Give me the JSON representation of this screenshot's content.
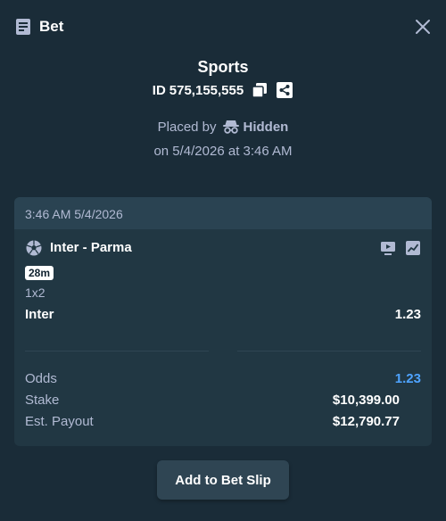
{
  "header": {
    "title": "Bet",
    "icon": "bet-slip-icon",
    "close_icon": "close-icon"
  },
  "bet": {
    "category": "Sports",
    "id_prefix": "ID",
    "id_value": "575,155,555",
    "placed_by_label": "Placed by",
    "placed_by_user": "Hidden",
    "date_line": "on 5/4/2026 at 3:46 AM"
  },
  "card": {
    "timestamp": "3:46 AM 5/4/2026",
    "event": {
      "name": "Inter - Parma",
      "sport_icon": "soccer-ball-icon",
      "time_badge": "28m",
      "market": "1x2",
      "selection": "Inter",
      "selection_odds": "1.23"
    },
    "summary": {
      "odds_label": "Odds",
      "odds_value": "1.23",
      "stake_label": "Stake",
      "stake_value": "$10,399.00",
      "payout_label": "Est. Payout",
      "payout_value": "$12,790.77"
    }
  },
  "actions": {
    "add_to_slip_label": "Add to Bet Slip"
  },
  "colors": {
    "background": "#1a2c38",
    "card": "#213743",
    "card_header": "#2a4352",
    "muted_text": "#b1bad3",
    "accent_blue": "#4ea3ff",
    "button": "#2f4553"
  }
}
